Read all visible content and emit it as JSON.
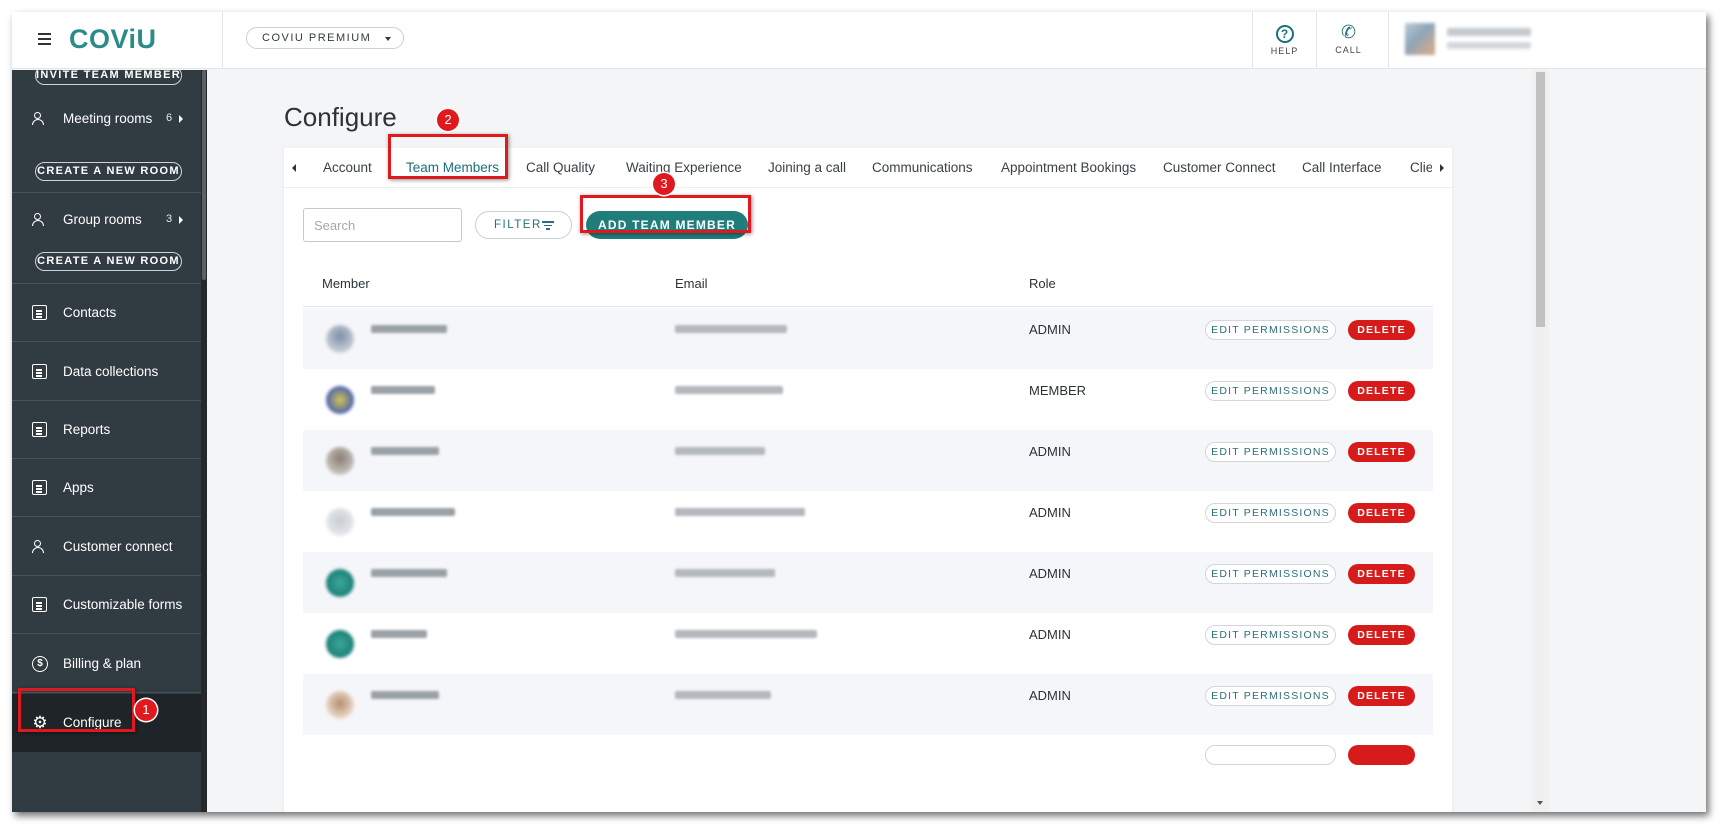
{
  "brand": {
    "logo": "COViU"
  },
  "topbar": {
    "plan": "COVIU PREMIUM",
    "help_label": "HELP",
    "help_icon": "?",
    "call_label": "CALL",
    "call_icon": "✆"
  },
  "sidebar": {
    "invite_button": "INVITE TEAM MEMBER",
    "meeting_rooms": {
      "label": "Meeting rooms",
      "count": "6",
      "create_button": "CREATE A NEW ROOM"
    },
    "group_rooms": {
      "label": "Group rooms",
      "count": "3",
      "create_button": "CREATE A NEW ROOM"
    },
    "items": [
      {
        "label": "Contacts",
        "icon": "contacts-icon"
      },
      {
        "label": "Data collections",
        "icon": "data-collections-icon"
      },
      {
        "label": "Reports",
        "icon": "reports-icon"
      },
      {
        "label": "Apps",
        "icon": "apps-icon"
      },
      {
        "label": "Customer connect",
        "icon": "customer-connect-icon"
      },
      {
        "label": "Customizable forms",
        "icon": "forms-icon"
      },
      {
        "label": "Billing & plan",
        "icon": "billing-icon",
        "glyph": "$"
      },
      {
        "label": "Configure",
        "icon": "gear-icon",
        "glyph": "⚙"
      }
    ]
  },
  "page": {
    "title": "Configure",
    "tabs": [
      "Account",
      "Team Members",
      "Call Quality",
      "Waiting Experience",
      "Joining a call",
      "Communications",
      "Appointment Bookings",
      "Customer Connect",
      "Call Interface",
      "Clie"
    ],
    "active_tab": "Team Members",
    "search_placeholder": "Search",
    "filter_label": "FILTER",
    "add_button": "ADD TEAM MEMBER"
  },
  "table": {
    "columns": [
      "Member",
      "Email",
      "Role"
    ],
    "rows": [
      {
        "role": "ADMIN"
      },
      {
        "role": "MEMBER"
      },
      {
        "role": "ADMIN"
      },
      {
        "role": "ADMIN"
      },
      {
        "role": "ADMIN"
      },
      {
        "role": "ADMIN"
      },
      {
        "role": "ADMIN"
      }
    ],
    "edit_label": "EDIT PERMISSIONS",
    "delete_label": "DELETE"
  },
  "annotations": {
    "step1": "1",
    "step2": "2",
    "step3": "3"
  },
  "colors": {
    "accent": "#1f7d7c",
    "sidebar": "#313c42",
    "danger": "#d71a1a",
    "annotation": "#e0191f"
  }
}
